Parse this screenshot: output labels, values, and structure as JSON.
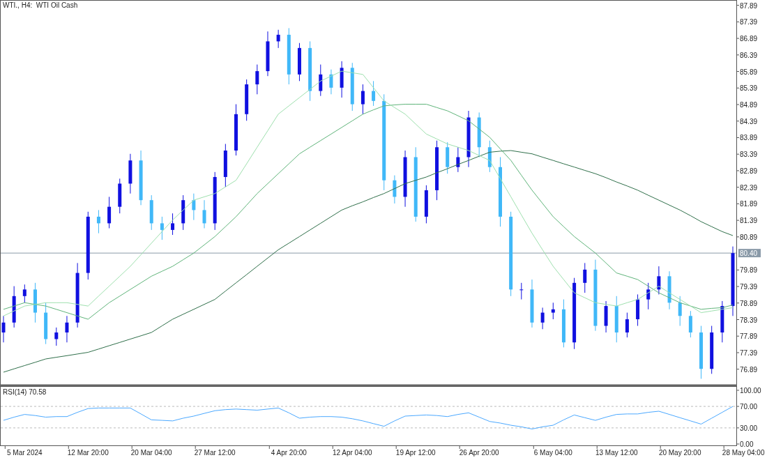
{
  "title": "WTI., H4:  WTI Oil Cash",
  "price_chart": {
    "chart_data": {
      "type": "candlestick",
      "ylim": [
        76.41,
        88.04
      ],
      "categories": [
        null,
        null,
        null,
        null,
        null,
        null,
        null,
        null,
        null,
        null,
        null,
        null,
        null,
        null,
        null,
        null,
        null,
        null,
        null,
        null,
        null,
        null,
        null,
        null,
        null,
        null,
        null,
        null,
        null,
        null,
        null,
        null,
        null,
        null,
        null,
        null,
        null,
        null,
        null,
        null,
        null,
        null,
        null,
        null,
        null,
        null,
        null,
        null,
        null,
        null,
        null,
        null,
        null,
        null,
        null,
        null,
        null,
        null,
        null,
        null,
        null,
        null,
        null,
        null,
        null,
        null,
        null,
        null,
        null,
        null
      ],
      "ohlc": [
        [
          78.0,
          78.5,
          77.7,
          78.3
        ],
        [
          78.3,
          79.4,
          78.15,
          79.1
        ],
        [
          79.1,
          79.45,
          78.9,
          79.3
        ],
        [
          79.3,
          79.5,
          78.3,
          78.6
        ],
        [
          78.6,
          78.9,
          77.65,
          77.8
        ],
        [
          77.8,
          78.15,
          77.6,
          78.0
        ],
        [
          78.0,
          78.5,
          77.7,
          78.3
        ],
        [
          78.3,
          80.1,
          78.15,
          79.8
        ],
        [
          79.8,
          81.65,
          79.6,
          81.5
        ],
        [
          81.5,
          81.7,
          81.0,
          81.3
        ],
        [
          81.3,
          82.1,
          81.15,
          81.8
        ],
        [
          81.8,
          82.65,
          81.6,
          82.5
        ],
        [
          82.5,
          83.4,
          82.2,
          83.2
        ],
        [
          83.2,
          83.5,
          81.85,
          82.0
        ],
        [
          82.0,
          82.15,
          81.1,
          81.3
        ],
        [
          81.3,
          81.5,
          80.8,
          81.1
        ],
        [
          81.1,
          81.6,
          80.95,
          81.3
        ],
        [
          81.3,
          82.15,
          81.1,
          82.0
        ],
        [
          82.0,
          82.2,
          81.4,
          81.7
        ],
        [
          81.7,
          82.0,
          81.15,
          81.3
        ],
        [
          81.3,
          82.85,
          81.1,
          82.7
        ],
        [
          82.7,
          83.7,
          82.4,
          83.5
        ],
        [
          83.5,
          84.9,
          83.35,
          84.6
        ],
        [
          84.6,
          85.65,
          84.4,
          85.5
        ],
        [
          85.5,
          86.1,
          85.2,
          85.9
        ],
        [
          85.9,
          87.1,
          85.75,
          86.8
        ],
        [
          86.8,
          87.15,
          86.6,
          87.0
        ],
        [
          87.0,
          87.2,
          85.5,
          85.8
        ],
        [
          85.8,
          86.75,
          85.6,
          86.6
        ],
        [
          86.6,
          86.8,
          85.0,
          85.3
        ],
        [
          85.3,
          86.1,
          85.15,
          85.8
        ],
        [
          85.8,
          85.95,
          85.2,
          85.4
        ],
        [
          85.4,
          86.2,
          85.1,
          86.0
        ],
        [
          86.0,
          86.15,
          84.7,
          84.9
        ],
        [
          84.9,
          85.5,
          84.6,
          85.3
        ],
        [
          85.3,
          85.6,
          84.85,
          85.0
        ],
        [
          85.0,
          85.2,
          82.3,
          82.6
        ],
        [
          82.6,
          82.75,
          81.9,
          82.1
        ],
        [
          82.1,
          83.5,
          81.8,
          83.3
        ],
        [
          83.3,
          83.6,
          81.35,
          81.5
        ],
        [
          81.5,
          82.45,
          81.3,
          82.3
        ],
        [
          82.3,
          83.8,
          82.0,
          83.6
        ],
        [
          83.6,
          83.75,
          82.8,
          83.0
        ],
        [
          83.0,
          83.6,
          82.85,
          83.3
        ],
        [
          83.3,
          84.7,
          83.0,
          84.5
        ],
        [
          84.5,
          84.65,
          83.3,
          83.6
        ],
        [
          83.6,
          83.8,
          82.85,
          83.0
        ],
        [
          83.0,
          83.3,
          81.2,
          81.5
        ],
        [
          81.5,
          81.65,
          79.1,
          79.3
        ],
        [
          79.3,
          79.5,
          79.0,
          79.3
        ],
        [
          79.3,
          79.6,
          78.15,
          78.3
        ],
        [
          78.3,
          78.75,
          78.1,
          78.6
        ],
        [
          78.6,
          78.9,
          78.4,
          78.7
        ],
        [
          78.7,
          79.0,
          77.55,
          77.7
        ],
        [
          77.7,
          79.65,
          77.5,
          79.5
        ],
        [
          79.5,
          80.1,
          79.2,
          79.9
        ],
        [
          79.9,
          80.2,
          78.05,
          78.2
        ],
        [
          78.2,
          78.95,
          78.0,
          78.8
        ],
        [
          78.8,
          79.1,
          77.7,
          78.0
        ],
        [
          78.0,
          78.6,
          77.85,
          78.4
        ],
        [
          78.4,
          79.15,
          78.2,
          79.0
        ],
        [
          79.0,
          79.5,
          78.7,
          79.3
        ],
        [
          79.3,
          80.0,
          79.15,
          79.7
        ],
        [
          79.7,
          79.85,
          78.7,
          78.9
        ],
        [
          78.9,
          79.1,
          78.2,
          78.5
        ],
        [
          78.5,
          78.65,
          77.85,
          78.0
        ],
        [
          78.0,
          78.2,
          76.6,
          76.9
        ],
        [
          76.9,
          78.2,
          76.75,
          78.0
        ],
        [
          78.0,
          78.95,
          77.7,
          78.8
        ],
        [
          78.8,
          80.6,
          78.5,
          80.4
        ]
      ],
      "yticks": [
        {
          "value": 87.89,
          "label": "87.89"
        },
        {
          "value": 87.39,
          "label": "87.39"
        },
        {
          "value": 86.89,
          "label": "86.89"
        },
        {
          "value": 86.39,
          "label": "86.39"
        },
        {
          "value": 85.89,
          "label": "85.89"
        },
        {
          "value": 85.39,
          "label": "85.39"
        },
        {
          "value": 84.89,
          "label": "84.89"
        },
        {
          "value": 84.39,
          "label": "84.39"
        },
        {
          "value": 83.89,
          "label": "83.89"
        },
        {
          "value": 83.39,
          "label": "83.39"
        },
        {
          "value": 82.89,
          "label": "82.89"
        },
        {
          "value": 82.39,
          "label": "82.39"
        },
        {
          "value": 81.89,
          "label": "81.89"
        },
        {
          "value": 81.39,
          "label": "81.39"
        },
        {
          "value": 80.89,
          "label": "80.89"
        },
        {
          "value": 80.4,
          "label": "80.40"
        },
        {
          "value": 79.89,
          "label": "79.89"
        },
        {
          "value": 79.39,
          "label": "79.39"
        },
        {
          "value": 78.89,
          "label": "78.89"
        },
        {
          "value": 78.39,
          "label": "78.39"
        },
        {
          "value": 77.89,
          "label": "77.89"
        },
        {
          "value": 77.39,
          "label": "77.39"
        },
        {
          "value": 76.89,
          "label": "76.89"
        }
      ],
      "series": [
        {
          "type": "line",
          "color": "#2f6f4a",
          "values": [
            76.8,
            76.9,
            77.0,
            77.1,
            77.2,
            77.25,
            77.3,
            77.35,
            77.4,
            77.5,
            77.6,
            77.7,
            77.8,
            77.9,
            78.0,
            78.2,
            78.4,
            78.55,
            78.7,
            78.85,
            79.0,
            79.25,
            79.5,
            79.75,
            80.0,
            80.25,
            80.5,
            80.7,
            80.9,
            81.1,
            81.3,
            81.5,
            81.7,
            81.83,
            81.95,
            82.08,
            82.2,
            82.35,
            82.5,
            82.6,
            82.7,
            82.83,
            82.95,
            83.08,
            83.2,
            83.33,
            83.45,
            83.48,
            83.5,
            83.45,
            83.4,
            83.3,
            83.2,
            83.1,
            83.0,
            82.9,
            82.8,
            82.68,
            82.55,
            82.43,
            82.3,
            82.15,
            82.0,
            81.85,
            81.7,
            81.53,
            81.35,
            81.2,
            81.05,
            80.93
          ]
        },
        {
          "type": "line",
          "color": "#5fb47a",
          "values": [
            78.7,
            78.8,
            78.9,
            78.85,
            78.8,
            78.7,
            78.6,
            78.5,
            78.4,
            78.65,
            78.9,
            79.1,
            79.3,
            79.5,
            79.7,
            79.85,
            80.0,
            80.2,
            80.4,
            80.65,
            80.9,
            81.2,
            81.5,
            81.85,
            82.2,
            82.5,
            82.8,
            83.1,
            83.4,
            83.6,
            83.8,
            84.0,
            84.2,
            84.4,
            84.6,
            84.73,
            84.85,
            84.88,
            84.9,
            84.9,
            84.9,
            84.8,
            84.7,
            84.55,
            84.4,
            84.15,
            83.9,
            83.55,
            83.2,
            82.75,
            82.3,
            81.9,
            81.5,
            81.2,
            80.9,
            80.65,
            80.4,
            80.1,
            79.8,
            79.7,
            79.6,
            79.4,
            79.2,
            79.05,
            78.9,
            78.8,
            78.7,
            78.73,
            78.75,
            78.83
          ]
        },
        {
          "type": "line",
          "color": "#9ee0ae",
          "values": [
            78.5,
            78.65,
            78.8,
            78.85,
            78.9,
            78.9,
            78.9,
            78.85,
            78.8,
            79.1,
            79.4,
            79.7,
            80.0,
            80.35,
            80.7,
            81.05,
            81.4,
            81.7,
            82.0,
            82.1,
            82.2,
            82.4,
            82.6,
            83.1,
            83.6,
            84.1,
            84.6,
            84.85,
            85.1,
            85.35,
            85.6,
            85.75,
            85.9,
            85.85,
            85.8,
            85.4,
            85.0,
            84.8,
            84.6,
            84.3,
            84.0,
            83.85,
            83.7,
            83.6,
            83.5,
            83.35,
            83.2,
            82.65,
            82.1,
            81.55,
            81.0,
            80.5,
            80.0,
            79.6,
            79.2,
            79.05,
            78.9,
            78.85,
            78.8,
            78.9,
            79.0,
            79.2,
            79.4,
            79.2,
            79.0,
            78.8,
            78.6,
            78.65,
            78.7,
            78.75
          ]
        }
      ],
      "ref_lines": [
        {
          "axis": "y",
          "value": 80.4
        }
      ]
    }
  },
  "rsi_panel": {
    "label": "RSI(14) 70.58",
    "chart_data": {
      "type": "line",
      "ylim": [
        -3.2,
        107.1
      ],
      "categories": [
        null,
        null,
        "5 Mar 2024",
        null,
        null,
        null,
        null,
        null,
        "12 Mar 20:00",
        null,
        null,
        null,
        null,
        null,
        "20 Mar 04:00",
        null,
        null,
        null,
        null,
        null,
        "27 Mar 12:00",
        null,
        null,
        null,
        null,
        null,
        null,
        "4 Apr 20:00",
        null,
        null,
        null,
        null,
        null,
        "12 Apr 04:00",
        null,
        null,
        null,
        null,
        null,
        "19 Apr 12:00",
        null,
        null,
        null,
        null,
        null,
        "26 Apr 20:00",
        null,
        null,
        null,
        null,
        null,
        null,
        "6 May 04:00",
        null,
        null,
        null,
        null,
        null,
        "13 May 12:00",
        null,
        null,
        null,
        null,
        null,
        "20 May 20:00",
        null,
        null,
        null,
        null,
        null,
        "28 May 04:00"
      ],
      "yticks": [
        {
          "value": 100,
          "label": "100.00"
        },
        {
          "value": 70,
          "label": "70.00"
        },
        {
          "value": 30,
          "label": "30.00"
        },
        {
          "value": 0,
          "label": "0.00"
        }
      ],
      "series": [
        {
          "color": "#4aa8ff",
          "values": [
            44,
            50,
            55,
            53,
            50,
            51,
            51,
            59,
            66,
            67,
            67,
            67,
            67,
            56,
            45,
            44,
            43,
            48,
            52,
            57,
            62,
            64,
            65,
            64,
            63,
            65,
            67,
            58,
            48,
            50,
            51,
            51,
            50,
            47,
            43,
            38,
            33,
            43,
            52,
            53,
            54,
            53,
            51,
            55,
            58,
            50,
            42,
            39,
            35,
            32,
            28,
            32,
            35,
            45,
            54,
            49,
            44,
            50,
            55,
            56,
            56,
            59,
            61,
            55,
            49,
            43,
            37,
            48,
            59,
            70,
            null
          ]
        }
      ]
    }
  }
}
